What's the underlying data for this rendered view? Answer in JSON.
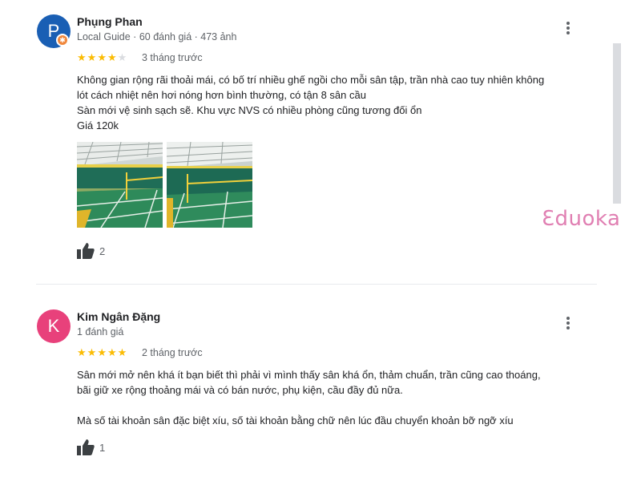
{
  "reviews": [
    {
      "avatar_letter": "P",
      "avatar_color": "#1a5fb4",
      "name": "Phụng Phan",
      "meta": "Local Guide · 60 đánh giá · 473 ảnh",
      "rating": 4,
      "time": "3 tháng trước",
      "text_lines": [
        "Không gian rộng rãi thoải mái, có bố trí nhiều ghế ngồi cho mỗi sân tập, trần nhà cao tuy nhiên không",
        "lót cách nhiệt nên hơi nóng hơn bình thường, có tận 8 sân cầu",
        "Sàn mới vệ sinh sạch sẽ. Khu vực NVS có nhiều phòng cũng tương đối ổn",
        "Giá 120k"
      ],
      "photos": [
        "badminton-court-photo-1",
        "badminton-court-photo-2"
      ],
      "likes": "2"
    },
    {
      "avatar_letter": "K",
      "avatar_color": "#e8417b",
      "name": "Kim Ngân Đặng",
      "meta": "1 đánh giá",
      "rating": 5,
      "time": "2 tháng trước",
      "text_lines": [
        "Sân mới mở nên khá ít bạn biết thì phải vì mình thấy sân khá ổn, thảm chuẩn, trần cũng cao thoáng,",
        "bãi giữ xe rộng thoảng mái và có bán nước, phụ kiện, cầu đầy đủ nữa.",
        "",
        "Mà số tài khoản sân đặc biệt xíu, số tài khoản bằng chữ nên lúc đầu chuyển khoản bỡ ngỡ xíu"
      ],
      "likes": "1"
    }
  ],
  "watermark": "Ɛduoka",
  "icons": {
    "more": "more-vert-icon",
    "like": "thumbs-up-icon",
    "guide": "local-guide-badge-icon",
    "star": "star-icon"
  }
}
